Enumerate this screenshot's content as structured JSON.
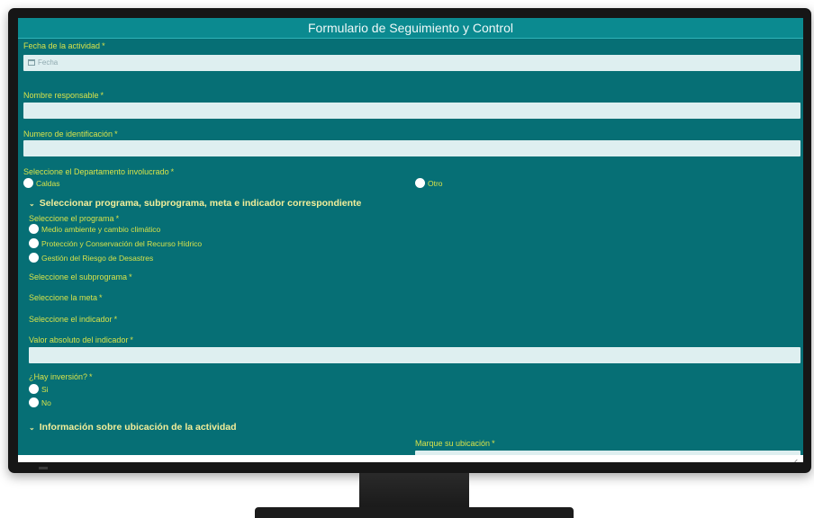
{
  "form": {
    "title": "Formulario de Seguimiento y Control",
    "required_mark": "*",
    "fecha": {
      "label": "Fecha de la actividad",
      "placeholder": "Fecha"
    },
    "responsable": {
      "label": "Nombre responsable"
    },
    "identificacion": {
      "label": "Numero de identificación"
    },
    "departamento": {
      "label": "Seleccione el Departamento involucrado",
      "options": [
        "Caldas",
        "Otro"
      ]
    },
    "section_programa": {
      "title": "Seleccionar programa, subprograma, meta e indicador correspondiente",
      "programa_label": "Seleccione el programa",
      "programa_options": [
        "Medio ambiente y cambio climático",
        "Protección y Conservación del Recurso Hídrico",
        "Gestión del Riesgo de Desastres"
      ],
      "subprograma_label": "Seleccione el subprograma",
      "meta_label": "Seleccione la meta",
      "indicador_label": "Seleccione el indicador",
      "valor_label": "Valor absoluto del indicador"
    },
    "inversion": {
      "label": "¿Hay inversión?",
      "options": [
        "Si",
        "No"
      ]
    },
    "section_ubicacion": {
      "title": "Información sobre ubicación de la actividad",
      "marque_label": "Marque su ubicación"
    },
    "submit_icon": "check-icon",
    "submit_glyph": "✓"
  },
  "colors": {
    "background": "#066f75",
    "titlebar": "#0b8a90",
    "label": "#d7e24a",
    "section": "#f2ee9a",
    "field": "#deeff0"
  }
}
